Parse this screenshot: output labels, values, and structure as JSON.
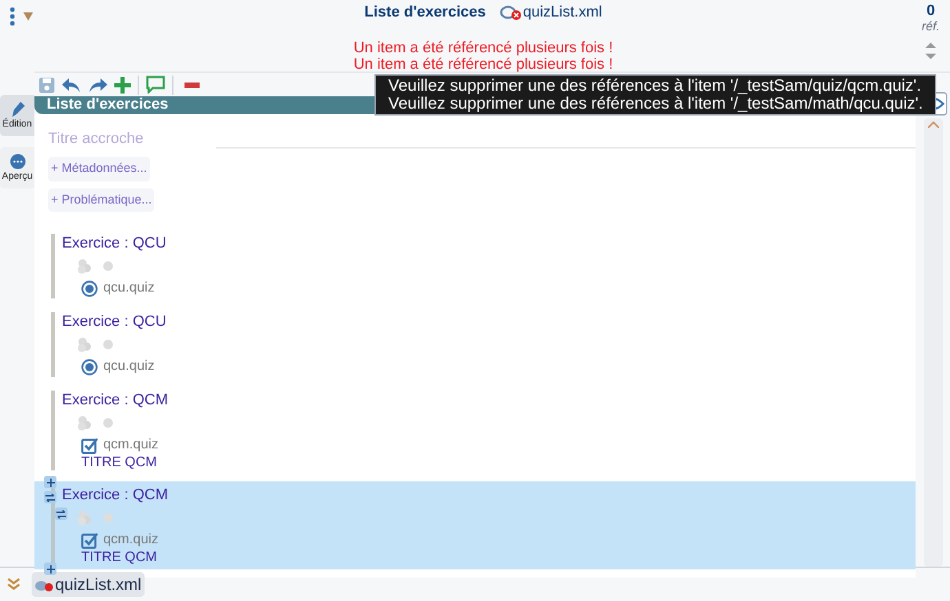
{
  "header": {
    "title": "Liste d'exercices",
    "file": "quizList.xml",
    "ref_count": "0",
    "ref_label": "réf."
  },
  "errors": [
    "Un item a été référencé plusieurs fois !",
    "Un item a été référencé plusieurs fois !"
  ],
  "tooltip": [
    "Veuillez supprimer une des références à l'item '/_testSam/quiz/qcm.quiz'.",
    "Veuillez supprimer une des références à l'item '/_testSam/math/qcu.quiz'."
  ],
  "sidebar": [
    {
      "label": "Édition",
      "selected": true
    },
    {
      "label": "Aperçu",
      "selected": false
    }
  ],
  "panel": {
    "title": "Liste d'exercices",
    "placeholder": "Titre accroche",
    "links": [
      "+ Métadonnées...",
      "+ Problématique..."
    ]
  },
  "exercises": [
    {
      "kind": "qcu",
      "title": "Exercice : QCU",
      "file": "qcu.quiz",
      "selected": false
    },
    {
      "kind": "qcu",
      "title": "Exercice : QCU",
      "file": "qcu.quiz",
      "selected": false
    },
    {
      "kind": "qcm",
      "title": "Exercice : QCM",
      "file": "qcm.quiz",
      "subtitle": "TITRE QCM",
      "selected": false
    },
    {
      "kind": "qcm",
      "title": "Exercice : QCM",
      "file": "qcm.quiz",
      "subtitle": "TITRE QCM",
      "selected": true
    }
  ],
  "bottom_tab": {
    "label": "quizList.xml"
  }
}
